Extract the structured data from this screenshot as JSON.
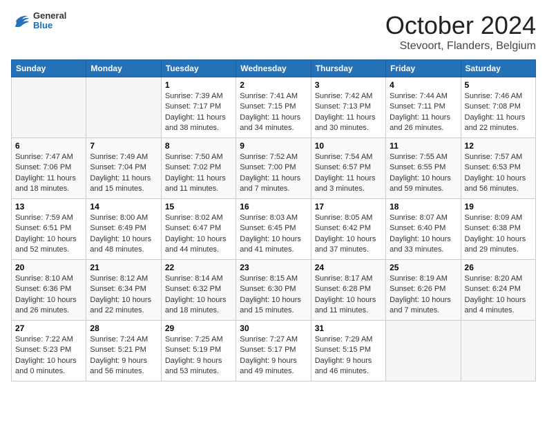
{
  "header": {
    "logo_general": "General",
    "logo_blue": "Blue",
    "month_title": "October 2024",
    "location": "Stevoort, Flanders, Belgium"
  },
  "weekdays": [
    "Sunday",
    "Monday",
    "Tuesday",
    "Wednesday",
    "Thursday",
    "Friday",
    "Saturday"
  ],
  "weeks": [
    [
      {
        "day": "",
        "detail": ""
      },
      {
        "day": "",
        "detail": ""
      },
      {
        "day": "1",
        "detail": "Sunrise: 7:39 AM\nSunset: 7:17 PM\nDaylight: 11 hours\nand 38 minutes."
      },
      {
        "day": "2",
        "detail": "Sunrise: 7:41 AM\nSunset: 7:15 PM\nDaylight: 11 hours\nand 34 minutes."
      },
      {
        "day": "3",
        "detail": "Sunrise: 7:42 AM\nSunset: 7:13 PM\nDaylight: 11 hours\nand 30 minutes."
      },
      {
        "day": "4",
        "detail": "Sunrise: 7:44 AM\nSunset: 7:11 PM\nDaylight: 11 hours\nand 26 minutes."
      },
      {
        "day": "5",
        "detail": "Sunrise: 7:46 AM\nSunset: 7:08 PM\nDaylight: 11 hours\nand 22 minutes."
      }
    ],
    [
      {
        "day": "6",
        "detail": "Sunrise: 7:47 AM\nSunset: 7:06 PM\nDaylight: 11 hours\nand 18 minutes."
      },
      {
        "day": "7",
        "detail": "Sunrise: 7:49 AM\nSunset: 7:04 PM\nDaylight: 11 hours\nand 15 minutes."
      },
      {
        "day": "8",
        "detail": "Sunrise: 7:50 AM\nSunset: 7:02 PM\nDaylight: 11 hours\nand 11 minutes."
      },
      {
        "day": "9",
        "detail": "Sunrise: 7:52 AM\nSunset: 7:00 PM\nDaylight: 11 hours\nand 7 minutes."
      },
      {
        "day": "10",
        "detail": "Sunrise: 7:54 AM\nSunset: 6:57 PM\nDaylight: 11 hours\nand 3 minutes."
      },
      {
        "day": "11",
        "detail": "Sunrise: 7:55 AM\nSunset: 6:55 PM\nDaylight: 10 hours\nand 59 minutes."
      },
      {
        "day": "12",
        "detail": "Sunrise: 7:57 AM\nSunset: 6:53 PM\nDaylight: 10 hours\nand 56 minutes."
      }
    ],
    [
      {
        "day": "13",
        "detail": "Sunrise: 7:59 AM\nSunset: 6:51 PM\nDaylight: 10 hours\nand 52 minutes."
      },
      {
        "day": "14",
        "detail": "Sunrise: 8:00 AM\nSunset: 6:49 PM\nDaylight: 10 hours\nand 48 minutes."
      },
      {
        "day": "15",
        "detail": "Sunrise: 8:02 AM\nSunset: 6:47 PM\nDaylight: 10 hours\nand 44 minutes."
      },
      {
        "day": "16",
        "detail": "Sunrise: 8:03 AM\nSunset: 6:45 PM\nDaylight: 10 hours\nand 41 minutes."
      },
      {
        "day": "17",
        "detail": "Sunrise: 8:05 AM\nSunset: 6:42 PM\nDaylight: 10 hours\nand 37 minutes."
      },
      {
        "day": "18",
        "detail": "Sunrise: 8:07 AM\nSunset: 6:40 PM\nDaylight: 10 hours\nand 33 minutes."
      },
      {
        "day": "19",
        "detail": "Sunrise: 8:09 AM\nSunset: 6:38 PM\nDaylight: 10 hours\nand 29 minutes."
      }
    ],
    [
      {
        "day": "20",
        "detail": "Sunrise: 8:10 AM\nSunset: 6:36 PM\nDaylight: 10 hours\nand 26 minutes."
      },
      {
        "day": "21",
        "detail": "Sunrise: 8:12 AM\nSunset: 6:34 PM\nDaylight: 10 hours\nand 22 minutes."
      },
      {
        "day": "22",
        "detail": "Sunrise: 8:14 AM\nSunset: 6:32 PM\nDaylight: 10 hours\nand 18 minutes."
      },
      {
        "day": "23",
        "detail": "Sunrise: 8:15 AM\nSunset: 6:30 PM\nDaylight: 10 hours\nand 15 minutes."
      },
      {
        "day": "24",
        "detail": "Sunrise: 8:17 AM\nSunset: 6:28 PM\nDaylight: 10 hours\nand 11 minutes."
      },
      {
        "day": "25",
        "detail": "Sunrise: 8:19 AM\nSunset: 6:26 PM\nDaylight: 10 hours\nand 7 minutes."
      },
      {
        "day": "26",
        "detail": "Sunrise: 8:20 AM\nSunset: 6:24 PM\nDaylight: 10 hours\nand 4 minutes."
      }
    ],
    [
      {
        "day": "27",
        "detail": "Sunrise: 7:22 AM\nSunset: 5:23 PM\nDaylight: 10 hours\nand 0 minutes."
      },
      {
        "day": "28",
        "detail": "Sunrise: 7:24 AM\nSunset: 5:21 PM\nDaylight: 9 hours\nand 56 minutes."
      },
      {
        "day": "29",
        "detail": "Sunrise: 7:25 AM\nSunset: 5:19 PM\nDaylight: 9 hours\nand 53 minutes."
      },
      {
        "day": "30",
        "detail": "Sunrise: 7:27 AM\nSunset: 5:17 PM\nDaylight: 9 hours\nand 49 minutes."
      },
      {
        "day": "31",
        "detail": "Sunrise: 7:29 AM\nSunset: 5:15 PM\nDaylight: 9 hours\nand 46 minutes."
      },
      {
        "day": "",
        "detail": ""
      },
      {
        "day": "",
        "detail": ""
      }
    ]
  ]
}
